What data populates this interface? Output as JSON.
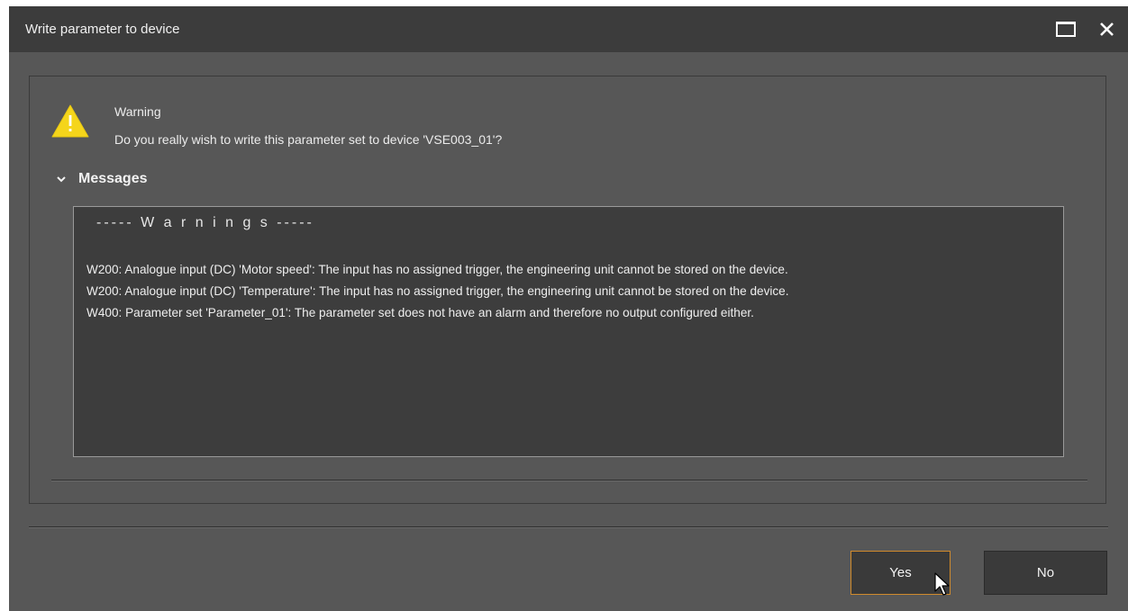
{
  "window": {
    "title": "Write parameter to device",
    "maximize_icon": "maximize-icon",
    "close_icon": "close-icon"
  },
  "warning": {
    "icon": "warning-triangle-icon",
    "icon_color": "#f5d51b",
    "label": "Warning",
    "question": "Do you really wish to write this parameter set to device 'VSE003_01'?"
  },
  "messages": {
    "toggle_label": "Messages",
    "expanded": true,
    "heading": "----- W a r n i n g s -----",
    "lines": [
      "W200: Analogue input (DC) 'Motor speed': The input has no assigned trigger, the engineering unit cannot be stored on the device.",
      "W200: Analogue input (DC) 'Temperature': The input has no assigned trigger, the engineering unit cannot be stored on the device.",
      "W400: Parameter set 'Parameter_01': The parameter set does not have an alarm and therefore no output configured either."
    ]
  },
  "buttons": {
    "yes_label": "Yes",
    "no_label": "No",
    "focus_color": "#d08a2c"
  }
}
